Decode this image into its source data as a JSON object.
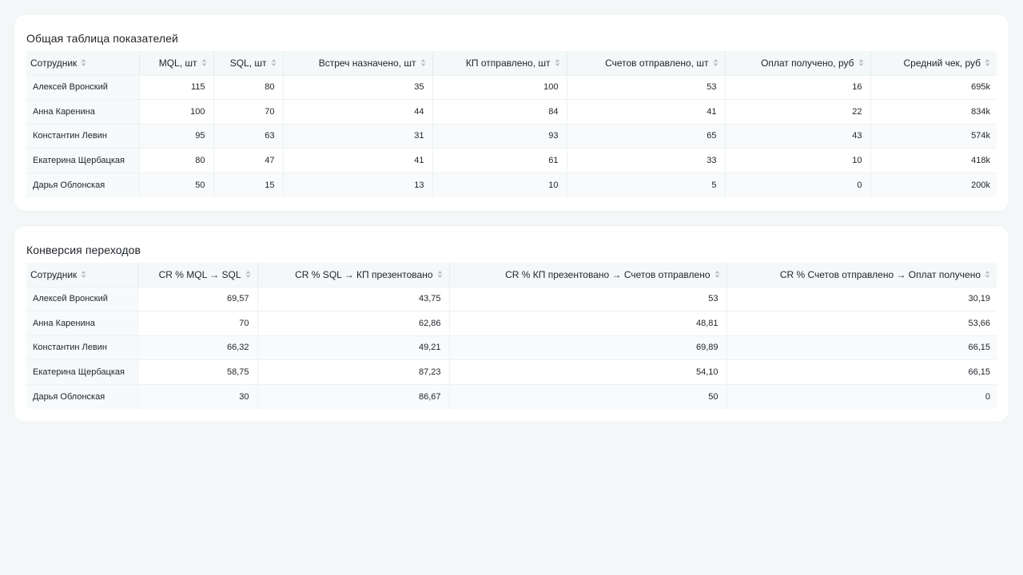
{
  "table1": {
    "title": "Общая таблица показателей",
    "headers": [
      "Сотрудник",
      "MQL, шт",
      "SQL, шт",
      "Встреч назначено, шт",
      "КП отправлено, шт",
      "Счетов отправлено, шт",
      "Оплат получено, руб",
      "Средний чек, руб"
    ],
    "rows": [
      [
        "Алексей Вронский",
        "115",
        "80",
        "35",
        "100",
        "53",
        "16",
        "695k"
      ],
      [
        "Анна Каренина",
        "100",
        "70",
        "44",
        "84",
        "41",
        "22",
        "834k"
      ],
      [
        "Константин Левин",
        "95",
        "63",
        "31",
        "93",
        "65",
        "43",
        "574k"
      ],
      [
        "Екатерина Щербацкая",
        "80",
        "47",
        "41",
        "61",
        "33",
        "10",
        "418k"
      ],
      [
        "Дарья Облонская",
        "50",
        "15",
        "13",
        "10",
        "5",
        "0",
        "200k"
      ]
    ]
  },
  "table2": {
    "title": "Конверсия переходов",
    "headers": [
      "Сотрудник",
      "CR % MQL → SQL",
      "CR % SQL → КП презентовано",
      "CR % КП презентовано → Счетов отправлено",
      "CR % Счетов отправлено → Оплат получено"
    ],
    "rows": [
      [
        "Алексей Вронский",
        "69,57",
        "43,75",
        "53",
        "30,19"
      ],
      [
        "Анна Каренина",
        "70",
        "62,86",
        "48,81",
        "53,66"
      ],
      [
        "Константин Левин",
        "66,32",
        "49,21",
        "69,89",
        "66,15"
      ],
      [
        "Екатерина Щербацкая",
        "58,75",
        "87,23",
        "54,10",
        "66,15"
      ],
      [
        "Дарья Облонская",
        "30",
        "86,67",
        "50",
        "0"
      ]
    ]
  },
  "icons": {
    "sort": "sort-icon"
  },
  "colors": {
    "page_background": "#f4f7f8",
    "card_background": "#ffffff",
    "header_background": "#f4f8f9",
    "sort_icon": "#b9c1c6"
  }
}
